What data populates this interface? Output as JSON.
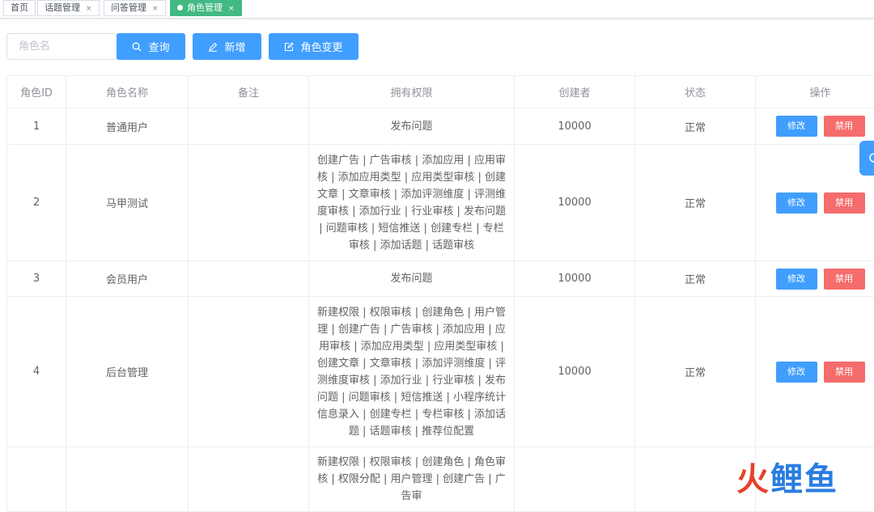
{
  "tabs": [
    {
      "label": "首页",
      "closable": false,
      "active": false
    },
    {
      "label": "话题管理",
      "closable": true,
      "active": false
    },
    {
      "label": "问答管理",
      "closable": true,
      "active": false
    },
    {
      "label": "角色管理",
      "closable": true,
      "active": true
    }
  ],
  "tab_close_glyph": "×",
  "toolbar": {
    "search_placeholder": "角色名",
    "query_label": "查询",
    "add_label": "新增",
    "change_label": "角色变更"
  },
  "table": {
    "headers": [
      "角色ID",
      "角色名称",
      "备注",
      "拥有权限",
      "创建者",
      "状态",
      "操作"
    ],
    "rows": [
      {
        "id": "1",
        "name": "普通用户",
        "note": "",
        "permissions": "发布问题",
        "creator": "10000",
        "status": "正常",
        "edit": "修改",
        "ban": "禁用"
      },
      {
        "id": "2",
        "name": "马甲测试",
        "note": "",
        "permissions": "创建广告 | 广告审核 | 添加应用 | 应用审核 | 添加应用类型 | 应用类型审核 | 创建文章 | 文章审核 | 添加评测维度 | 评测维度审核 | 添加行业 | 行业审核 | 发布问题 | 问题审核 | 短信推送 | 创建专栏 | 专栏审核 | 添加话题 | 话题审核",
        "creator": "10000",
        "status": "正常",
        "edit": "修改",
        "ban": "禁用"
      },
      {
        "id": "3",
        "name": "会员用户",
        "note": "",
        "permissions": "发布问题",
        "creator": "10000",
        "status": "正常",
        "edit": "修改",
        "ban": "禁用"
      },
      {
        "id": "4",
        "name": "后台管理",
        "note": "",
        "permissions": "新建权限 | 权限审核 | 创建角色 | 用户管理 | 创建广告 | 广告审核 | 添加应用 | 应用审核 | 添加应用类型 | 应用类型审核 | 创建文章 | 文章审核 | 添加评测维度 | 评测维度审核 | 添加行业 | 行业审核 | 发布问题 | 问题审核 | 短信推送 | 小程序统计信息录入 | 创建专栏 | 专栏审核 | 添加话题 | 话题审核 | 推荐位配置",
        "creator": "10000",
        "status": "正常",
        "edit": "修改",
        "ban": "禁用"
      },
      {
        "id": "",
        "name": "",
        "note": "",
        "permissions": "新建权限 | 权限审核 | 创建角色 | 角色审核 | 权限分配 | 用户管理 | 创建广告 | 广告审",
        "creator": "",
        "status": "",
        "edit": "",
        "ban": ""
      }
    ]
  },
  "watermark": {
    "part1": "火",
    "part2": "鲤鱼"
  },
  "colors": {
    "primary": "#409eff",
    "danger": "#f56c6c",
    "active_tab": "#42b983"
  }
}
